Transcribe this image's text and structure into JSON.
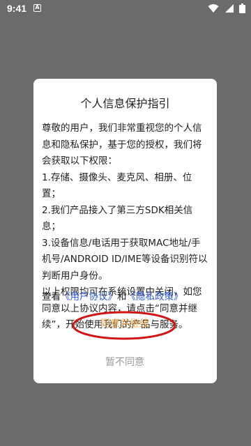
{
  "status_bar": {
    "time": "9:41",
    "notification_glyph": "A",
    "icons": [
      "wifi-icon",
      "signal-icon",
      "battery-icon"
    ]
  },
  "dialog": {
    "title": "个人信息保护指引",
    "body_lines": [
      "尊敬的用户，我们非常重视您的个人信",
      "息和隐私保护，基于您的授权，我们将",
      "会获取以下权限：",
      "1.存储、摄像头、麦克风、相册、位置；",
      "2.我们产品接入了第三方SDK相关信息；",
      "3.设备信息/电话用于获取MAC地址/手",
      "机号/ANDROID ID/IME等设备识别符以",
      "判断用户身份。",
      "以上权限均可在系统设置中关闭，如您",
      "同意以上协议内容，请点击“同意并继",
      "续”，开始使用我们的产品与服务。"
    ],
    "links": {
      "prefix": "查看",
      "user_agreement": "《用户协议》",
      "conjunction": "和",
      "privacy_policy": "《隐私政策》"
    },
    "agree_label": "同意并继续",
    "decline_label": "暂不同意"
  },
  "colors": {
    "overlay": "#6b6b6b",
    "link": "#2f5be0",
    "agree": "#f0a84a",
    "decline": "#9a9a9a",
    "highlight_ellipse": "#d01515"
  }
}
